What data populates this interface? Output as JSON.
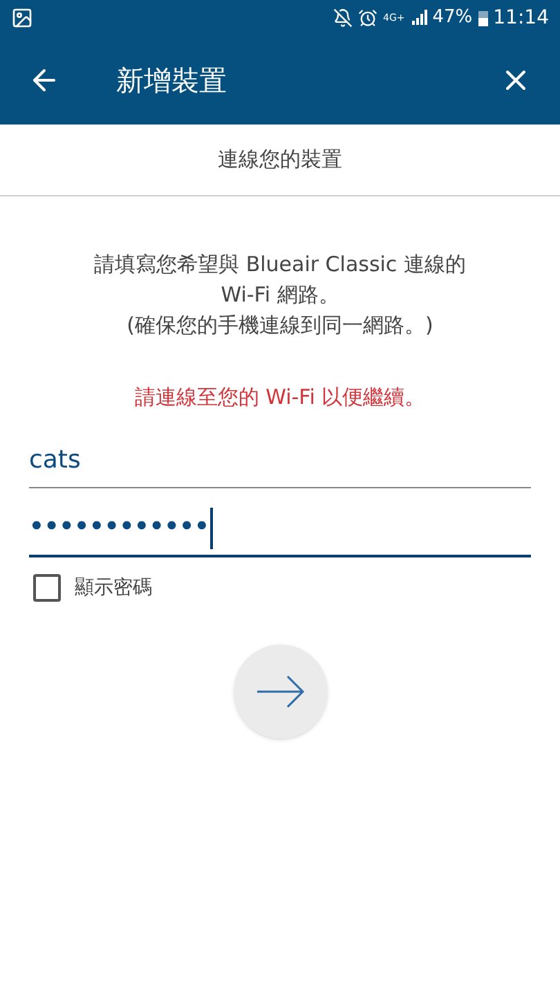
{
  "status_bar": {
    "network": "4G+",
    "battery": "47%",
    "time": "11:14"
  },
  "app_bar": {
    "title": "新增裝置"
  },
  "subtitle": "連線您的裝置",
  "instructions": [
    "請填寫您希望與 Blueair Classic 連線的",
    "Wi-Fi 網路。",
    "(確保您的手機連線到同一網路。)"
  ],
  "error": "請連線至您的 Wi-Fi 以便繼續。",
  "fields": [
    {
      "kind": "text",
      "value": "cats",
      "focused": false
    },
    {
      "kind": "password",
      "value": "••••••••••••",
      "focused": true
    }
  ],
  "show_password": {
    "label": "顯示密碼",
    "checked": false
  }
}
